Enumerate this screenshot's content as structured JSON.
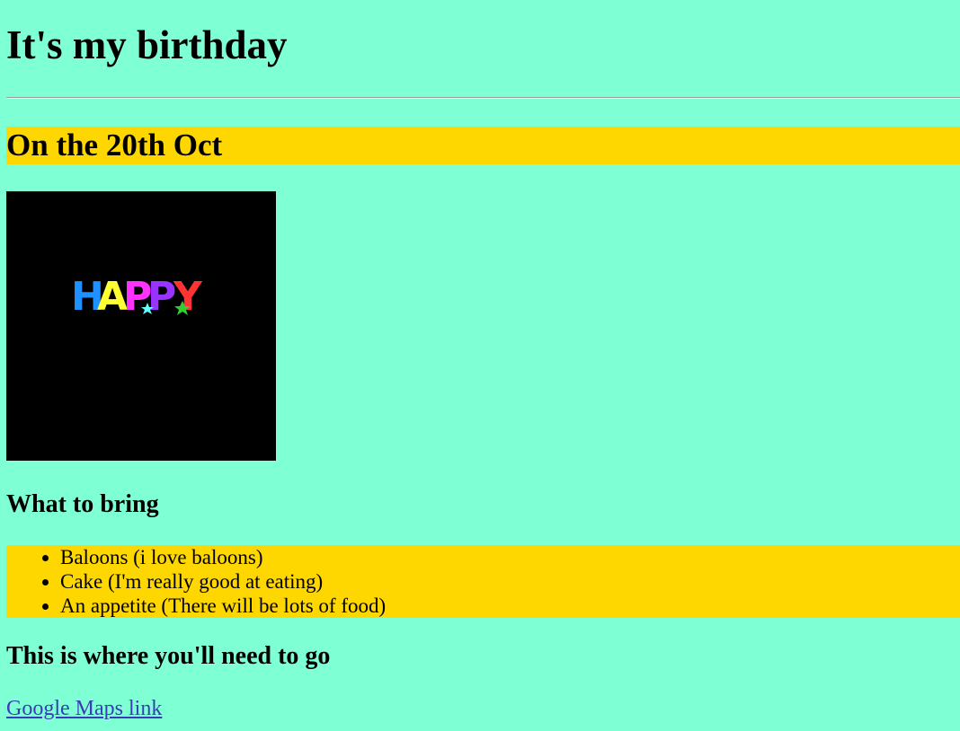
{
  "page": {
    "background": "#7FFFD4",
    "highlight_color": "#FFD700",
    "title": "It's my birthday",
    "date_heading": "On the 20th Oct",
    "image": {
      "description_icon": "happy-birthday-gif-icon",
      "text": "HAPPY"
    },
    "bring": {
      "heading": "What to bring",
      "items": [
        "Baloons (i love baloons)",
        "Cake (I'm really good at eating)",
        "An appetite (There will be lots of food)"
      ]
    },
    "location": {
      "heading": "This is where you'll need to go",
      "link_text": "Google Maps link",
      "link_color": "#3b3bb8"
    }
  }
}
